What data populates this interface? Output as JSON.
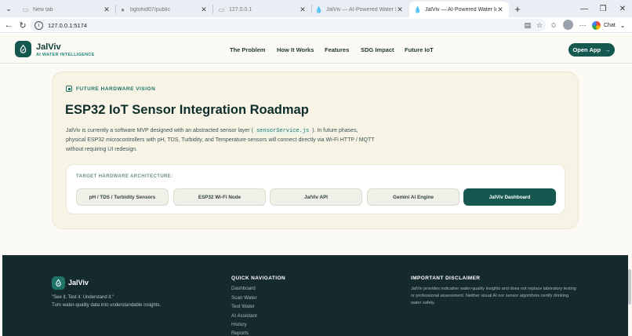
{
  "browser": {
    "tabs": [
      {
        "label": "New tab",
        "favicon": "page-icon"
      },
      {
        "label": "bgtohid07/public",
        "favicon": "github-icon"
      },
      {
        "label": "127.0.0.1",
        "favicon": "page-icon"
      },
      {
        "label": "JalViv — AI-Powered Water Intellig",
        "favicon": "droplet-icon"
      },
      {
        "label": "JalViv — AI-Powered Water Intellig",
        "favicon": "droplet-icon"
      }
    ],
    "url": "127.0.0.1:5174",
    "chat_label": "Chat"
  },
  "header": {
    "brand_name": "JalViv",
    "brand_tagline": "AI WATER INTELLIGENCE",
    "nav": [
      "The Problem",
      "How It Works",
      "Features",
      "SDG Impact",
      "Future IoT"
    ],
    "cta": "Open App"
  },
  "roadmap": {
    "eyebrow": "FUTURE HARDWARE VISION",
    "title": "ESP32 IoT Sensor Integration Roadmap",
    "desc_part1": "JalViv is currently a software MVP designed with an abstracted sensor layer (",
    "code": "sensorService.js",
    "desc_part2": "). In future phases, physical ESP32 microcontrollers with pH, TDS, Turbidity, and Temperature sensors will connect directly via Wi-Fi HTTP / MQTT without requiring UI redesign.",
    "arch_label": "TARGET HARDWARE ARCHITECTURE:",
    "arch_steps": [
      "pH / TDS / Turbidity Sensors",
      "ESP32 Wi-Fi Node",
      "JalViv API",
      "Gemini AI Engine",
      "JalViv Dashboard"
    ]
  },
  "footer": {
    "brand": "JalViv",
    "quote": "\"See it. Test it. Understand it.\"",
    "sub": "Turn water-quality data into understandable insights.",
    "nav_heading": "QUICK NAVIGATION",
    "nav_links": [
      "Dashboard",
      "Scan Water",
      "Test Water",
      "AI Assistant",
      "History",
      "Reports"
    ],
    "disclaimer_heading": "IMPORTANT DISCLAIMER",
    "disclaimer": "JalViv provides indicative water-quality insights and does not replace laboratory testing or professional assessment. Neither visual AI nor sensor algorithms certify drinking water safety."
  },
  "colors": {
    "brand": "#14584f",
    "accent": "#1f7468",
    "page_bg": "#fbfaf4",
    "footer_bg": "#152a2d"
  }
}
